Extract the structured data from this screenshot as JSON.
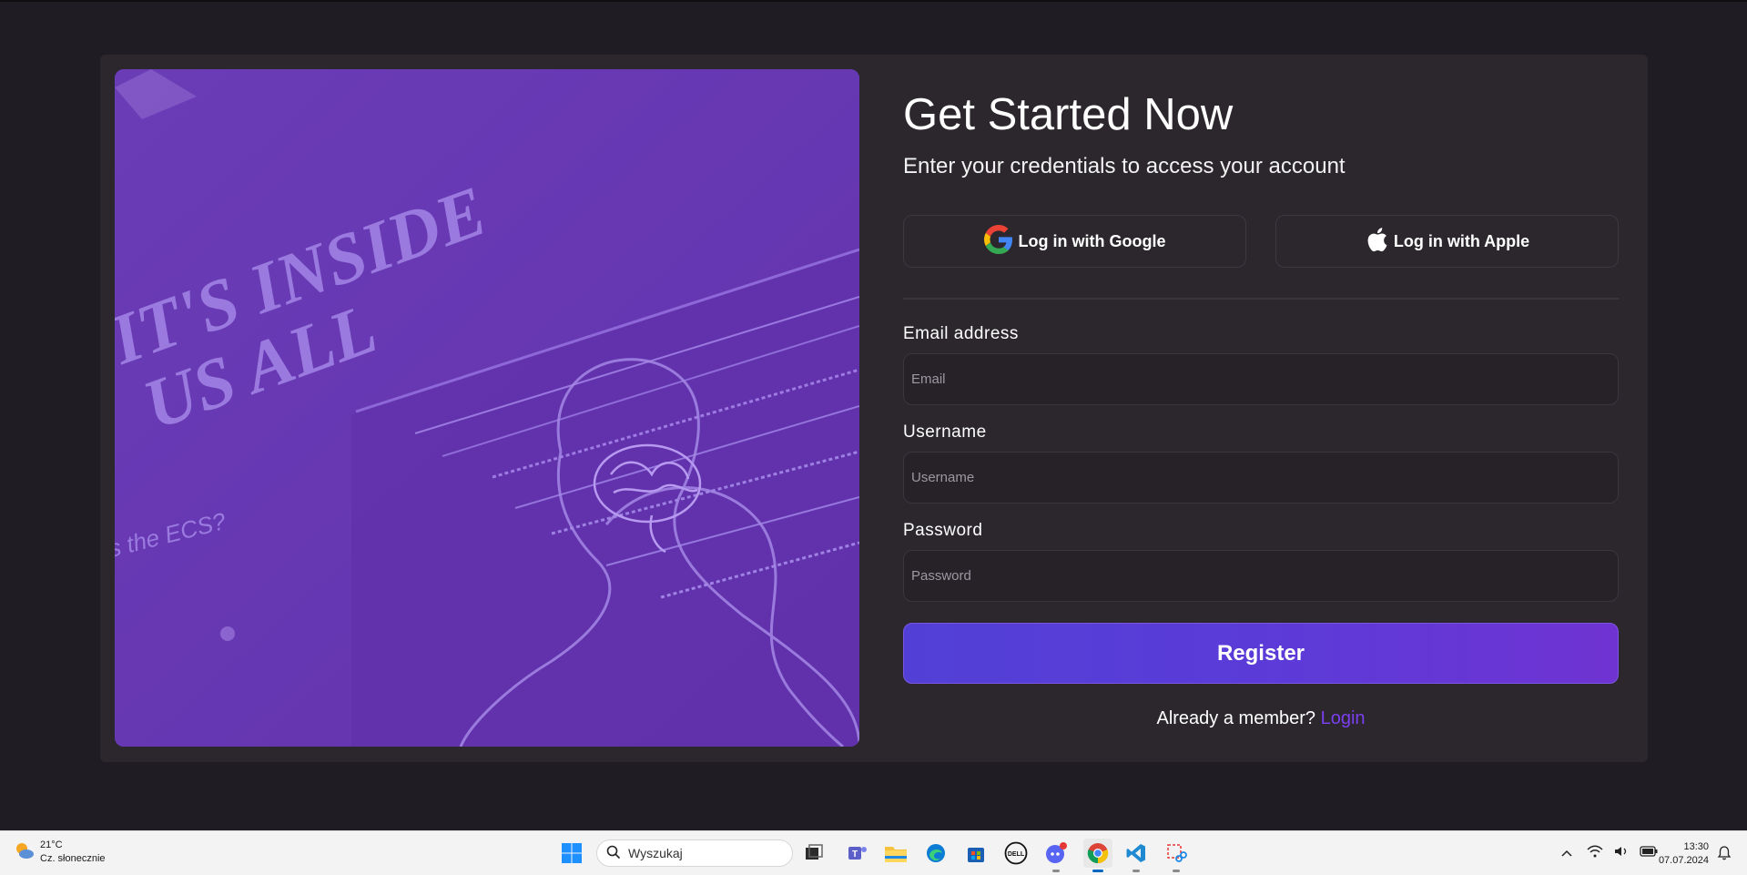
{
  "form": {
    "title": "Get Started Now",
    "subtitle": "Enter your credentials to access your account",
    "google_label": "Log in with Google",
    "apple_label": "Log in with Apple",
    "email_label": "Email address",
    "email_placeholder": "Email",
    "username_label": "Username",
    "username_placeholder": "Username",
    "password_label": "Password",
    "password_placeholder": "Password",
    "register_label": "Register",
    "member_text": "Already a member?",
    "login_link": "Login"
  },
  "hero": {
    "headline_1": "IT'S INSIDE",
    "headline_2": "US ALL",
    "side_text": "s the ECS?"
  },
  "taskbar": {
    "temperature": "21°C",
    "weather_text": "Cz. słonecznie",
    "search_placeholder": "Wyszukaj",
    "time": "13:30",
    "date": "07.07.2024",
    "dell_label": "DELL"
  },
  "colors": {
    "accent": "#7b3ff0",
    "hero_tint": "#6636b0",
    "card_bg": "#2b272d"
  }
}
